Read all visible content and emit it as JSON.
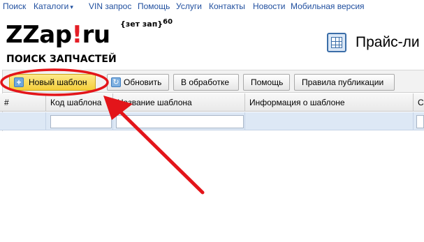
{
  "nav": {
    "items": [
      "Поиск",
      "Каталоги",
      "VIN запрос",
      "Помощь",
      "Услуги",
      "Контакты",
      "Новости",
      "Мобильная версия"
    ],
    "catalog_caret": "▾"
  },
  "logo": {
    "main_a": "ZZap",
    "bang": "!",
    "main_b": "ru",
    "sup_text": "{зет зап}",
    "sup_num": "60",
    "subtitle": "ПОИСК ЗАПЧАСТЕЙ"
  },
  "page": {
    "title": "Прайс-ли",
    "title_icon": "spreadsheet-icon"
  },
  "toolbar": {
    "new_template": "Новый шаблон",
    "refresh": "Обновить",
    "in_progress": "В обработке",
    "help": "Помощь",
    "rules": "Правила публикации",
    "new_icon": "plus-icon",
    "refresh_icon": "refresh-icon"
  },
  "grid": {
    "columns": [
      "#",
      "Код шаблона",
      "Название шаблона",
      "Информация о шаблоне",
      "С"
    ]
  },
  "colors": {
    "link": "#1f4e9e",
    "accent_red": "#e41e26",
    "new_button": "#f5cf3a",
    "filter_row": "#dde8f5",
    "annotation": "#e3151a"
  }
}
